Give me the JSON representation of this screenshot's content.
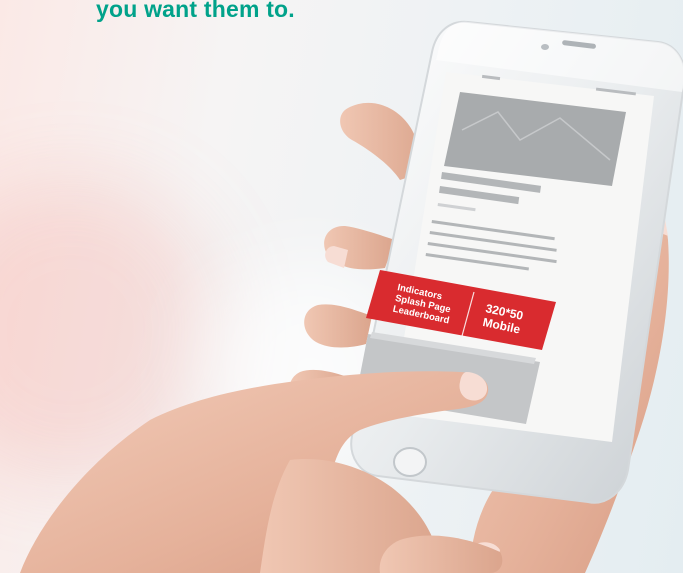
{
  "headline": "you want them to.",
  "phone": {
    "ad_banner": {
      "left_text_lines": [
        "Indicators",
        "Splash Page",
        "Leaderboard"
      ],
      "right_text_lines": [
        "320*50",
        "Mobile"
      ],
      "color": "#d92b2f"
    }
  },
  "colors": {
    "headline": "#00a28a",
    "ad_red": "#d92b2f",
    "skin": "#e9b9a3",
    "nail": "#f7ddd4"
  }
}
